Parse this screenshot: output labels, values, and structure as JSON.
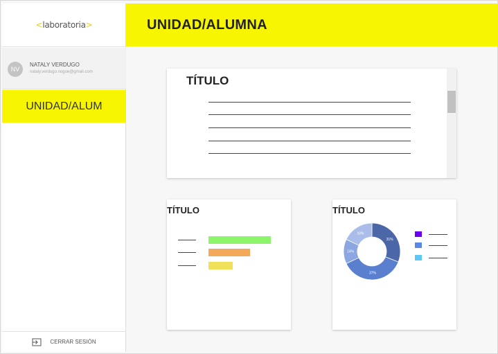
{
  "sidebar": {
    "logo_text": "laboratoria",
    "logo_left": "<",
    "logo_right": ">",
    "user": {
      "initials": "NV",
      "name": "NATALY VERDUGO",
      "email": "nataly.verdugo.nogue@gmail.com"
    },
    "active_item": "UNIDAD/ALUM",
    "logout_label": "CERRAR SESIÓN"
  },
  "header": {
    "title": "UNIDAD/ALUMNA"
  },
  "cards": {
    "top_title": "TÍTULO",
    "bar_title": "TÍTULO",
    "pie_title": "TÍTULO"
  },
  "colors": {
    "accent": "#f7f600",
    "bar1": "#8cf56c",
    "bar2": "#f4a95a",
    "bar3": "#f0e05a",
    "pie": [
      "#4b67a8",
      "#5b7fcf",
      "#8ba6e0",
      "#a9bcea"
    ],
    "legend": [
      "#6a00f0",
      "#5b86e5",
      "#5cc8f5"
    ]
  },
  "chart_data": [
    {
      "type": "bar",
      "title": "TÍTULO",
      "categories": [
        "",
        "",
        ""
      ],
      "values": [
        90,
        60,
        35
      ]
    },
    {
      "type": "pie",
      "title": "TÍTULO",
      "labels": [
        "31%",
        "37%",
        "14%",
        "18%"
      ],
      "values": [
        31,
        37,
        14,
        18
      ]
    }
  ]
}
